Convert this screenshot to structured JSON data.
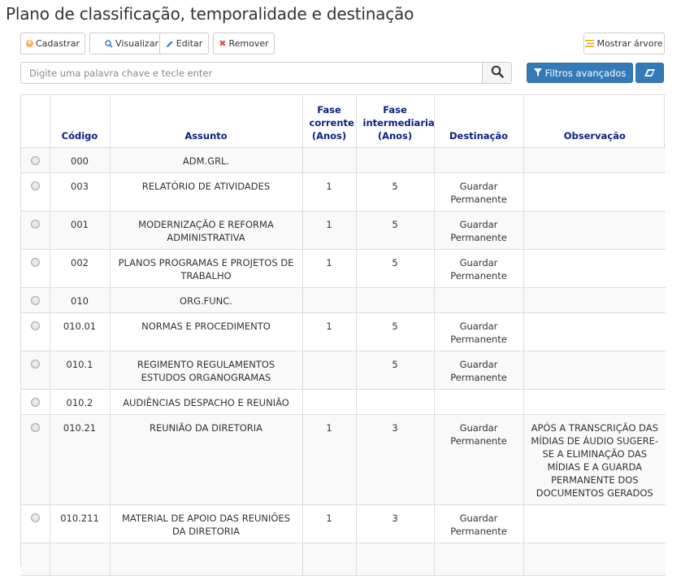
{
  "page": {
    "title": "Plano de classificação, temporalidade e destinação"
  },
  "toolbar": {
    "cadastrar": "Cadastrar",
    "visualizar": "Visualizar",
    "editar": "Editar",
    "remover": "Remover",
    "mostrar_arvore": "Mostrar árvore"
  },
  "search": {
    "placeholder": "Digite uma palavra chave e tecle enter",
    "value": "",
    "filtros_label": "Filtros avançados"
  },
  "colors": {
    "primary": "#337ab7",
    "header_text": "#0b1f7f",
    "add_icon": "#f0ad4e",
    "remove_icon": "#d9534f"
  },
  "table": {
    "headers": {
      "codigo": "Código",
      "assunto": "Assunto",
      "fase_corrente": "Fase corrente (Anos)",
      "fase_intermediaria": "Fase intermediaria (Anos)",
      "destinacao": "Destinação",
      "observacao": "Observação"
    },
    "rows": [
      {
        "codigo": "000",
        "assunto": "ADM.GRL.",
        "corrente": "",
        "intermediaria": "",
        "destinacao": "",
        "observacao": ""
      },
      {
        "codigo": "003",
        "assunto": "RELATÓRIO DE ATIVIDADES",
        "corrente": "1",
        "intermediaria": "5",
        "destinacao": "Guardar Permanente",
        "observacao": ""
      },
      {
        "codigo": "001",
        "assunto": "MODERNIZAÇÃO E REFORMA ADMINISTRATIVA",
        "corrente": "1",
        "intermediaria": "5",
        "destinacao": "Guardar Permanente",
        "observacao": ""
      },
      {
        "codigo": "002",
        "assunto": "PLANOS PROGRAMAS E PROJETOS DE TRABALHO",
        "corrente": "1",
        "intermediaria": "5",
        "destinacao": "Guardar Permanente",
        "observacao": ""
      },
      {
        "codigo": "010",
        "assunto": "ORG.FUNC.",
        "corrente": "",
        "intermediaria": "",
        "destinacao": "",
        "observacao": ""
      },
      {
        "codigo": "010.01",
        "assunto": "NORMAS E PROCEDIMENTO",
        "corrente": "1",
        "intermediaria": "5",
        "destinacao": "Guardar Permanente",
        "observacao": ""
      },
      {
        "codigo": "010.1",
        "assunto": "REGIMENTO REGULAMENTOS ESTUDOS ORGANOGRAMAS",
        "corrente": "",
        "intermediaria": "5",
        "destinacao": "Guardar Permanente",
        "observacao": ""
      },
      {
        "codigo": "010.2",
        "assunto": "AUDIÊNCIAS DESPACHO E REUNIÃO",
        "corrente": "",
        "intermediaria": "",
        "destinacao": "",
        "observacao": ""
      },
      {
        "codigo": "010.21",
        "assunto": "REUNIÃO DA DIRETORIA",
        "corrente": "1",
        "intermediaria": "3",
        "destinacao": "Guardar Permanente",
        "observacao": "APÓS A TRANSCRIÇÃO DAS MÍDIAS DE ÁUDIO SUGERE-SE A ELIMINAÇÃO DAS MÍDIAS E A GUARDA PERMANENTE DOS DOCUMENTOS GERADOS"
      },
      {
        "codigo": "010.211",
        "assunto": "MATERIAL DE APOIO DAS REUNIÕES DA DIRETORIA",
        "corrente": "1",
        "intermediaria": "3",
        "destinacao": "Guardar Permanente",
        "observacao": ""
      }
    ]
  }
}
